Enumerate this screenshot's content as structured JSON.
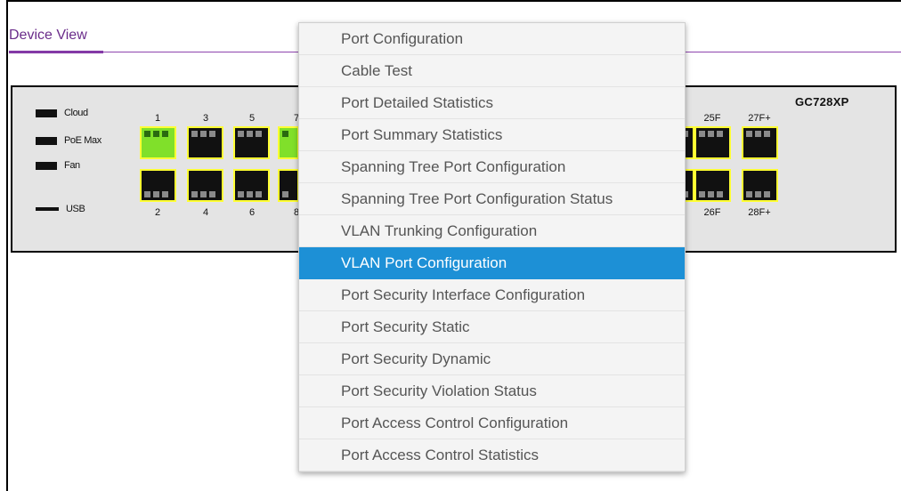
{
  "header": {
    "title": "Device View"
  },
  "device": {
    "model": "GC728XP",
    "leds": [
      "Cloud",
      "PoE Max",
      "Fan",
      "USB"
    ],
    "ports_top_labels": [
      "1",
      "3",
      "5",
      "7",
      "25F",
      "27F+"
    ],
    "ports_bottom_labels": [
      "2",
      "4",
      "6",
      "8",
      "26F",
      "28F+"
    ],
    "port_status_top": [
      "up",
      "down",
      "down",
      "up",
      "down",
      "down",
      "down"
    ],
    "port_status_bottom": [
      "down",
      "down",
      "down",
      "down",
      "down",
      "down",
      "down"
    ],
    "colors": {
      "port_highlight": "#ffff33",
      "port_link_up": "#80e02a",
      "accent": "#7b2fa0"
    }
  },
  "menu": {
    "items": [
      "Port Configuration",
      "Cable Test",
      "Port Detailed Statistics",
      "Port Summary Statistics",
      "Spanning Tree Port Configuration",
      "Spanning Tree Port Configuration Status",
      "VLAN Trunking Configuration",
      "VLAN Port Configuration",
      "Port Security Interface Configuration",
      "Port Security Static",
      "Port Security Dynamic",
      "Port Security Violation Status",
      "Port Access Control Configuration",
      "Port Access Control Statistics"
    ],
    "selected": "VLAN Port Configuration",
    "highlight_color": "#1d90d6"
  }
}
